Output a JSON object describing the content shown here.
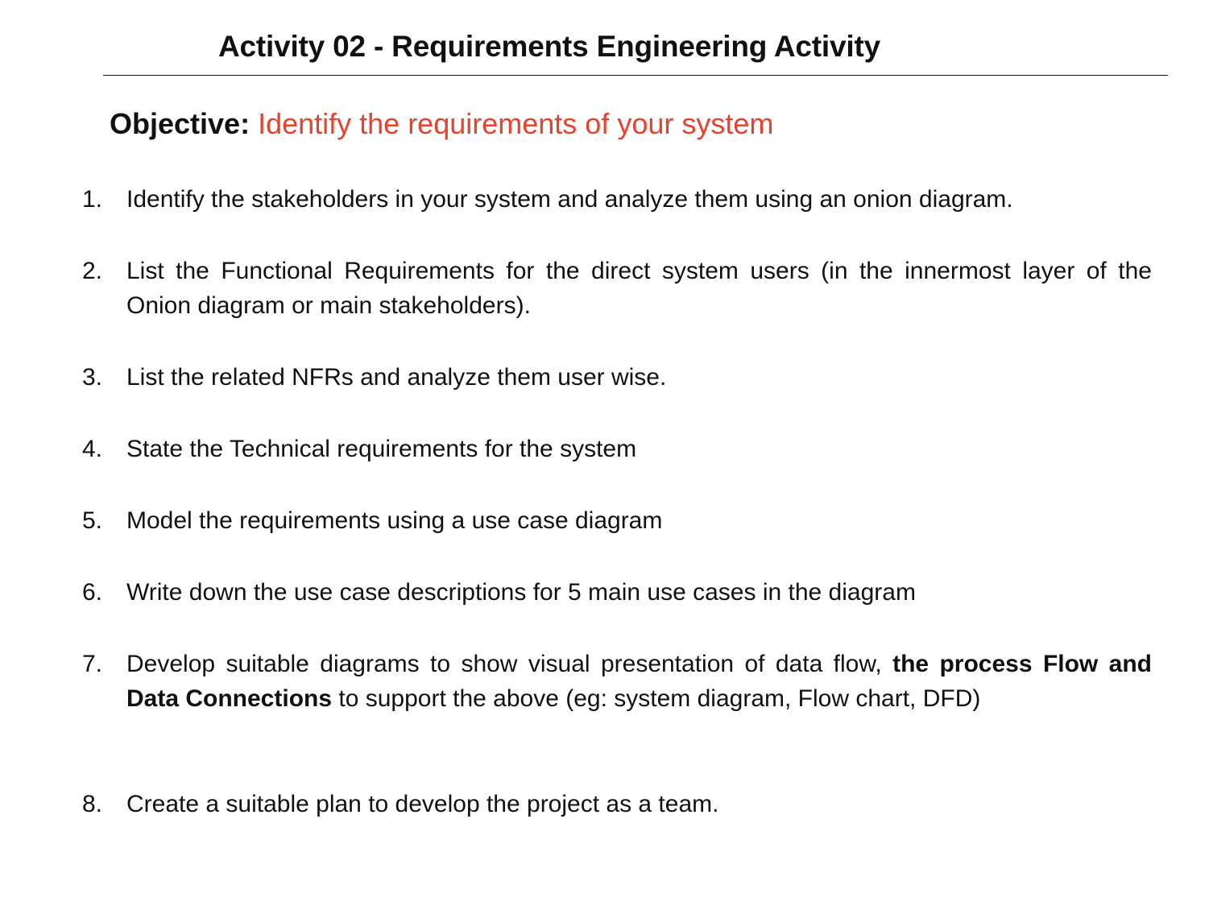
{
  "title": "Activity 02 - Requirements Engineering Activity",
  "objective": {
    "label": "Objective:",
    "text": "Identify the requirements of your system",
    "text_color": "#e8412c"
  },
  "items": [
    {
      "number": "1.",
      "text": "Identify the stakeholders in your system and analyze them using an onion diagram."
    },
    {
      "number": "2.",
      "text": "List the Functional Requirements for the direct system users (in the innermost layer of the Onion diagram or main stakeholders)."
    },
    {
      "number": "3.",
      "text": "List the related NFRs and analyze them user wise."
    },
    {
      "number": "4.",
      "text": "State the Technical requirements for the system"
    },
    {
      "number": "5.",
      "text": "Model the requirements using a use case diagram"
    },
    {
      "number": "6.",
      "text": "Write down the use case descriptions for 5 main use cases in the diagram"
    },
    {
      "number": "7.",
      "text_before": "Develop suitable diagrams to show visual presentation of data flow,",
      "text_bold": "the process Flow and Data Connections",
      "text_after": "to support the above (eg: system diagram, Flow chart, DFD)"
    },
    {
      "number": "8.",
      "text": "Create a suitable plan to develop the project as a team."
    }
  ]
}
